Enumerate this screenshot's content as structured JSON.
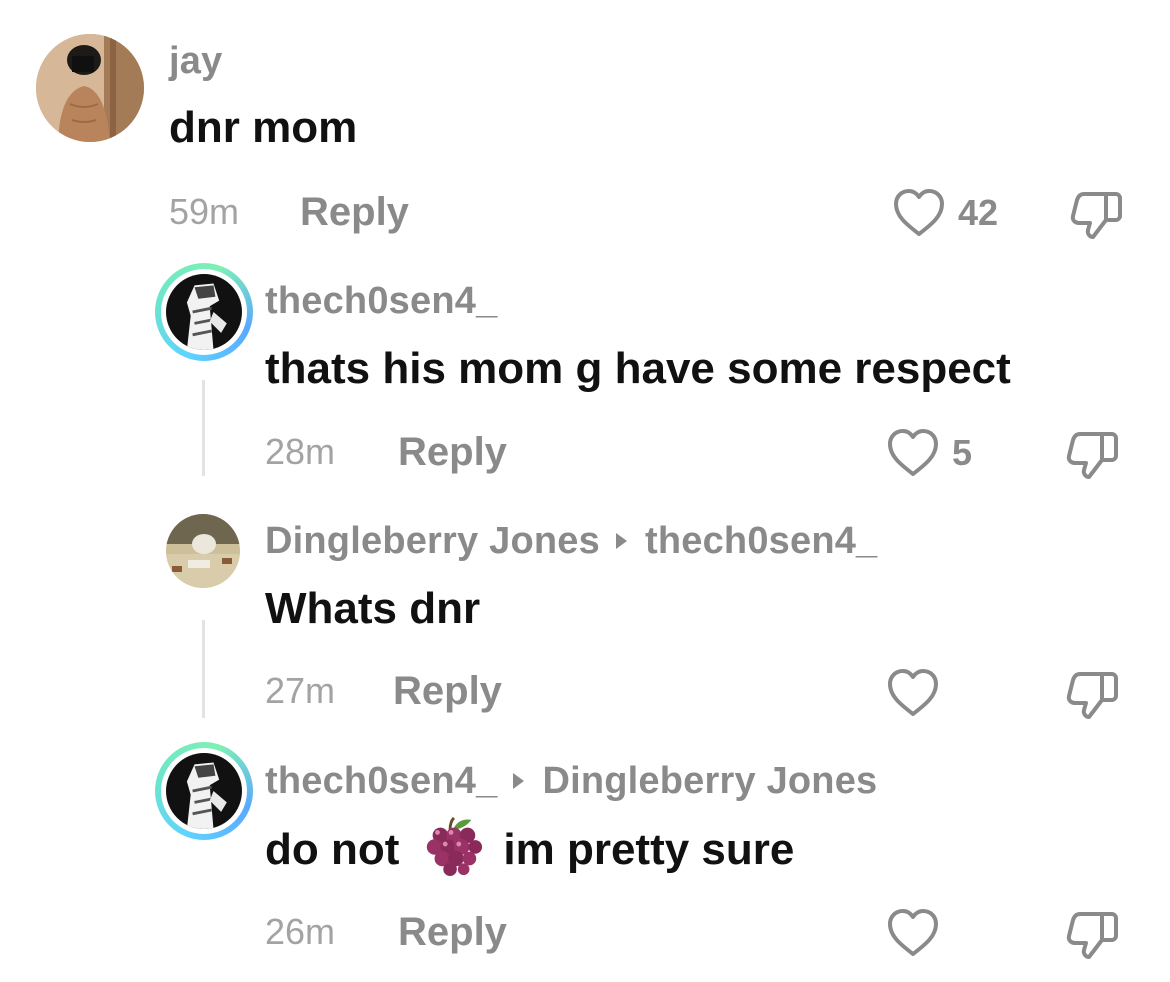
{
  "comments": [
    {
      "username": "jay",
      "text": "dnr mom",
      "time": "59m",
      "reply_label": "Reply",
      "likes": "42"
    },
    {
      "username": "thech0sen4_",
      "text": "thats his mom g have some respect",
      "time": "28m",
      "reply_label": "Reply",
      "likes": "5"
    },
    {
      "username": "Dingleberry Jones",
      "reply_to": "thech0sen4_",
      "text": "Whats dnr",
      "time": "27m",
      "reply_label": "Reply",
      "likes": ""
    },
    {
      "username": "thech0sen4_",
      "reply_to": "Dingleberry Jones",
      "text_before": "do not",
      "emoji": "grapes",
      "text_after": "im pretty sure",
      "time": "26m",
      "reply_label": "Reply",
      "likes": ""
    }
  ],
  "icons": {
    "like": "heart-outline-icon",
    "dislike": "thumbs-down-outline-icon",
    "reply_arrow": "reply-to-arrow-icon"
  },
  "colors": {
    "username": "#8a8a8a",
    "text": "#111111",
    "time": "#a3a3a3",
    "story_ring_start": "#5fd3ff",
    "story_ring_end": "#7ff0b6"
  }
}
